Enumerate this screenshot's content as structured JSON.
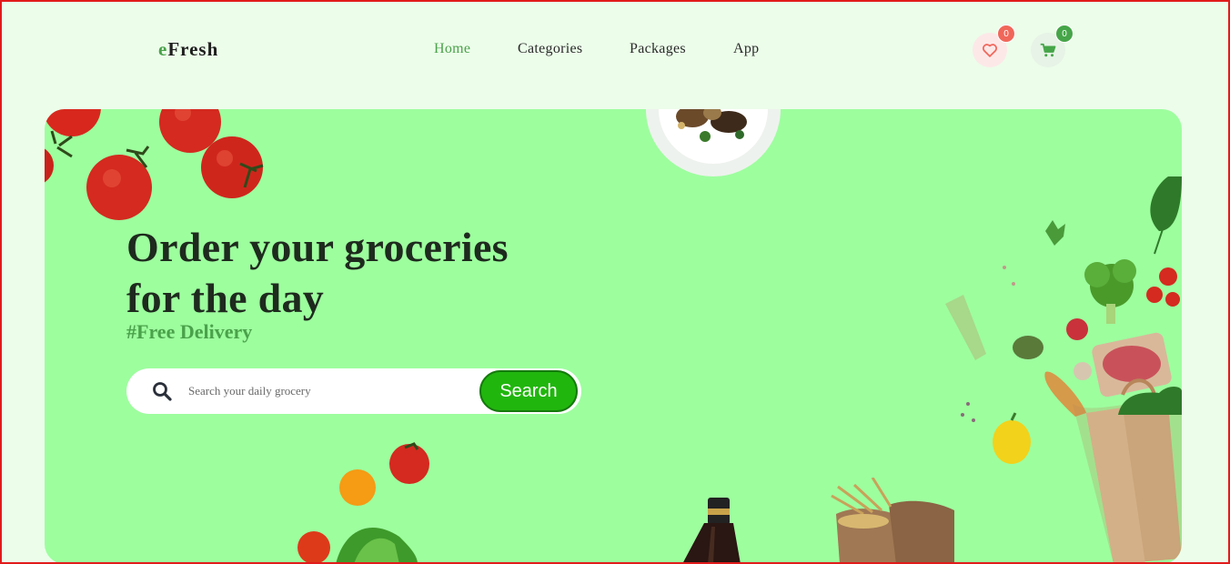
{
  "header": {
    "logo_first_letter": "e",
    "logo_rest": "Fresh",
    "nav": [
      {
        "label": "Home",
        "active": true
      },
      {
        "label": "Categories",
        "active": false
      },
      {
        "label": "Packages",
        "active": false
      },
      {
        "label": "App",
        "active": false
      }
    ],
    "wishlist": {
      "icon": "heart-icon",
      "count": "0"
    },
    "cart": {
      "icon": "cart-icon",
      "count": "0"
    }
  },
  "hero": {
    "title_line1": "Order your groceries",
    "title_line2": "for the day",
    "subtitle": "#Free Delivery",
    "search_placeholder": "Search your daily grocery",
    "search_button": "Search"
  },
  "colors": {
    "page_bg": "#ecfdea",
    "hero_bg": "#9dfe9e",
    "accent_green": "#4aa24a",
    "search_button": "#21b60e",
    "badge_red": "#f0675a"
  }
}
